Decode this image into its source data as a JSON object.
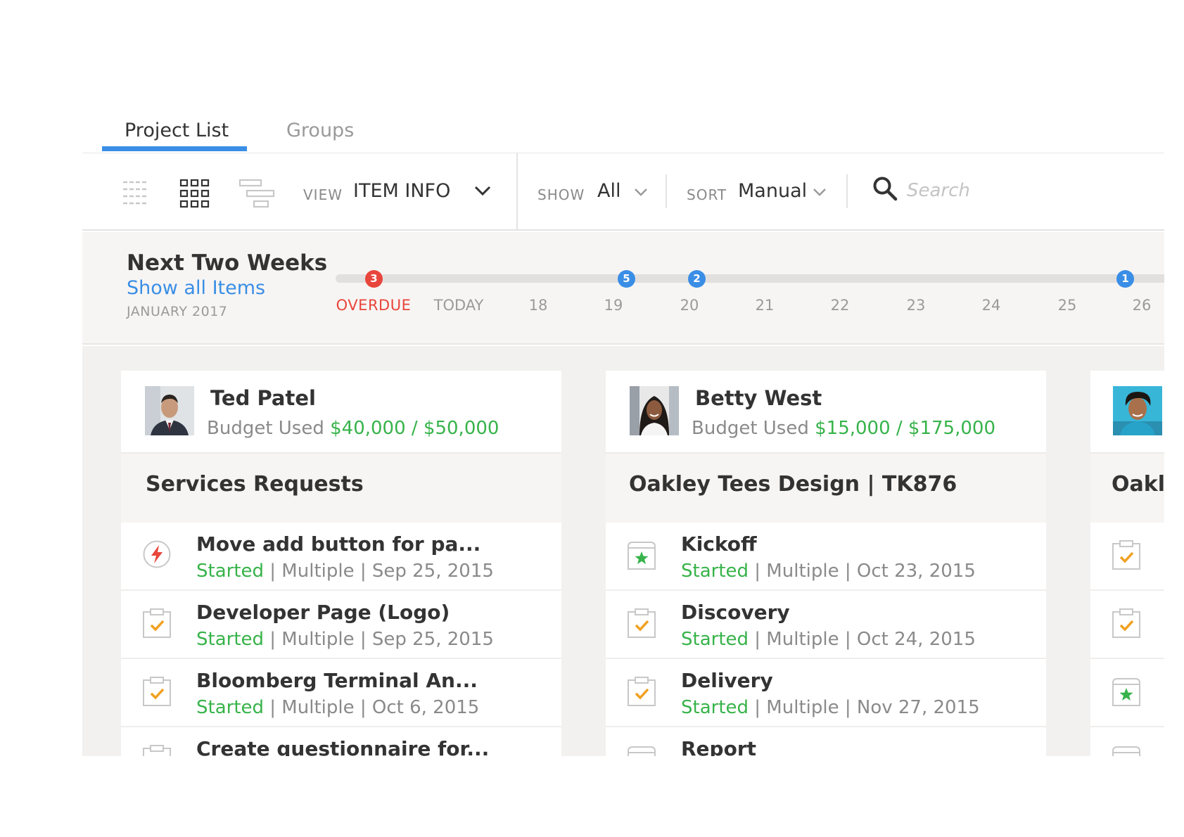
{
  "tabs": [
    {
      "label": "Project List",
      "active": true
    },
    {
      "label": "Groups",
      "active": false
    }
  ],
  "toolbar": {
    "view_label": "VIEW",
    "view_value": "ITEM INFO",
    "show_label": "SHOW",
    "show_value": "All",
    "sort_label": "SORT",
    "sort_value": "Manual",
    "search_placeholder": "Search",
    "icons": [
      "list-view-icon",
      "grid-view-icon",
      "gantt-view-icon",
      "chevron-down-icon",
      "search-icon"
    ]
  },
  "timeline": {
    "title": "Next Two Weeks",
    "link": "Show all Items",
    "month": "JANUARY 2017",
    "days": [
      "OVERDUE",
      "TODAY",
      "18",
      "19",
      "20",
      "21",
      "22",
      "23",
      "24",
      "25",
      "26"
    ],
    "badges": {
      "overdue": "3",
      "d19": "5",
      "d20": "2",
      "d26": "1"
    }
  },
  "cards": [
    {
      "name": "Ted Patel",
      "budget_label": "Budget Used",
      "budget_value": "$40,000 / $50,000",
      "project": "Services Requests",
      "tasks": [
        {
          "title": "Move add button for pa...",
          "status": "Started",
          "rest": " | Multiple | Sep 25, 2015",
          "icon": "bolt-icon"
        },
        {
          "title": "Developer Page (Logo)",
          "status": "Started",
          "rest": " | Multiple | Sep 25, 2015",
          "icon": "clipboard-check-icon"
        },
        {
          "title": "Bloomberg Terminal An...",
          "status": "Started",
          "rest": " | Multiple | Oct 6, 2015",
          "icon": "clipboard-check-icon"
        },
        {
          "title": "Create questionnaire for...",
          "status": "",
          "rest": "",
          "icon": "clipboard-check-icon"
        }
      ]
    },
    {
      "name": "Betty West",
      "budget_label": "Budget Used",
      "budget_value": "$15,000 / $175,000",
      "project": "Oakley Tees Design | TK876",
      "tasks": [
        {
          "title": "Kickoff",
          "status": "Started",
          "rest": " | Multiple | Oct 23, 2015",
          "icon": "milestone-star-icon"
        },
        {
          "title": "Discovery",
          "status": "Started",
          "rest": " | Multiple | Oct 24, 2015",
          "icon": "clipboard-check-icon"
        },
        {
          "title": "Delivery",
          "status": "Started",
          "rest": " | Multiple | Nov 27, 2015",
          "icon": "clipboard-check-icon"
        },
        {
          "title": "Report",
          "status": "",
          "rest": "",
          "icon": "milestone-star-icon"
        }
      ]
    },
    {
      "project": "Oakl",
      "tasks": [
        {
          "icon": "clipboard-check-icon"
        },
        {
          "icon": "clipboard-check-icon"
        },
        {
          "icon": "milestone-star-icon"
        },
        {
          "icon": "milestone-star-icon"
        }
      ]
    }
  ],
  "colors": {
    "accent_blue": "#3a8ee6",
    "overdue_red": "#e8453c",
    "status_green": "#37b34a",
    "check_orange": "#f0a020"
  }
}
